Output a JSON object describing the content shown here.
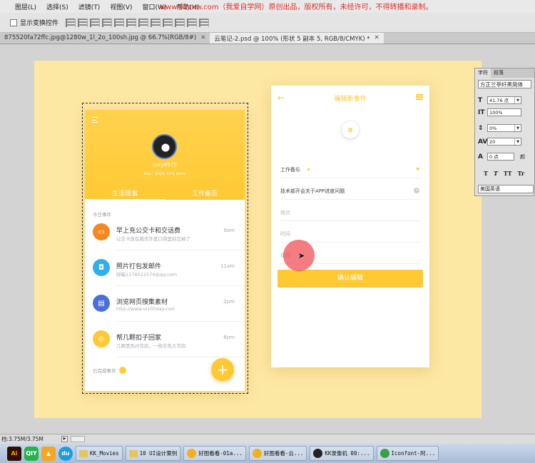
{
  "menubar": {
    "items": [
      "图层(L)",
      "选择(S)",
      "滤镜(T)",
      "视图(V)",
      "窗口(W)",
      "帮助(H)"
    ],
    "watermark": "www.52zxw.com（我爱自学网）原创出品，版权所有，未经许可，不得转播和录制。"
  },
  "options": {
    "show_transform_label": "显示变换控件"
  },
  "tabs": [
    {
      "label": "875520fa72ffc.jpg@1280w_1l_2o_100sh.jpg @ 66.7%(RGB/8#)"
    },
    {
      "label": "云笔记-2.psd @ 100% (形状 5 副本 5, RGB/8/CMYK) *"
    }
  ],
  "phone1": {
    "username": "Lucy6575",
    "stats": "Sep：2016  35% done",
    "tabs": [
      "生活琐事",
      "工作备忘"
    ],
    "section_today": "今日事件",
    "tasks": [
      {
        "title": "早上充公交卡和交话费",
        "sub": "公交卡放在我衣外套口袋里别忘掉了",
        "time": "9am",
        "color": "#f5871f",
        "icon": "battery-icon"
      },
      {
        "title": "照片打包发邮件",
        "sub": "邮箱1178522574@qq.com",
        "time": "11am",
        "color": "#2fb0e8",
        "icon": "camera-icon"
      },
      {
        "title": "浏览网页搜集素材",
        "sub": "http://www.ui100day.com",
        "time": "2pm",
        "color": "#4a6fd8",
        "icon": "book-icon"
      },
      {
        "title": "帮几颗扣子回家",
        "sub": "几颗黑色衬衣扣，一枚灰色大衣扣",
        "time": "8pm",
        "color": "#ffc933",
        "icon": "button-icon"
      }
    ],
    "section_done": "已完成事件",
    "fab": "+"
  },
  "phone2": {
    "back": "←",
    "title": "编辑新事件",
    "fields": [
      {
        "text": "工作备忘",
        "kind": "select"
      },
      {
        "text": "技术部开会关于APP进度问题",
        "kind": "value"
      },
      {
        "text": "地点",
        "kind": "placeholder"
      },
      {
        "text": "时间",
        "kind": "placeholder"
      },
      {
        "text": "提醒",
        "kind": "placeholder"
      }
    ],
    "confirm": "确认编辑"
  },
  "char_panel": {
    "tabs": [
      "字符",
      "段落"
    ],
    "font": "方正兰亭纤黑简体",
    "size": "41.76 点",
    "vscale": "100%",
    "baseline_pct": "0%",
    "tracking": "20",
    "shift": "0 点",
    "color_label": "颜",
    "style_buttons": [
      "T",
      "T",
      "TT",
      "Tr"
    ],
    "language": "美国英语"
  },
  "status": {
    "doc_size": "档:3.75M/3.75M"
  },
  "taskbar": [
    {
      "label": "KK_Movies",
      "type": "folder"
    },
    {
      "label": "10 UI设计案例",
      "type": "folder"
    },
    {
      "label": "好图看看-01a...",
      "type": "app"
    },
    {
      "label": "好图看看-云...",
      "type": "app"
    },
    {
      "label": "KK录像机 00:...",
      "type": "app"
    },
    {
      "label": "Iconfont-阿...",
      "type": "app"
    }
  ]
}
